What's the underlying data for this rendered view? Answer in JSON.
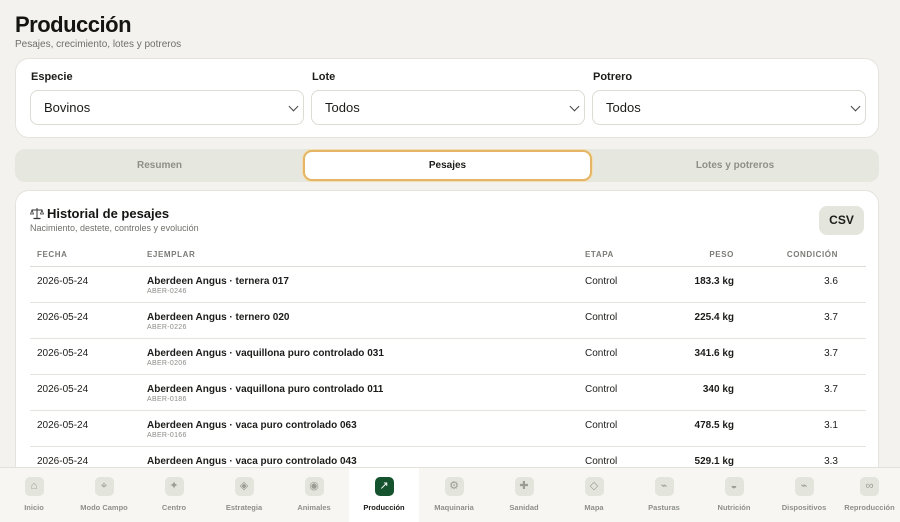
{
  "header": {
    "title": "Producción",
    "subtitle": "Pesajes, crecimiento, lotes y potreros"
  },
  "filters": [
    {
      "label": "Especie",
      "value": "Bovinos"
    },
    {
      "label": "Lote",
      "value": "Todos"
    },
    {
      "label": "Potrero",
      "value": "Todos"
    }
  ],
  "tabs": [
    {
      "label": "Resumen",
      "active": false
    },
    {
      "label": "Pesajes",
      "active": true
    },
    {
      "label": "Lotes y potreros",
      "active": false
    }
  ],
  "history": {
    "title": "Historial de pesajes",
    "subtitle": "Nacimiento, destete, controles y evolución",
    "csv_label": "CSV",
    "columns": {
      "fecha": "FECHA",
      "ejemplar": "EJEMPLAR",
      "etapa": "ETAPA",
      "peso": "PESO",
      "condicion": "CONDICIÓN"
    },
    "rows": [
      {
        "fecha": "2026-05-24",
        "ejemplar": "Aberdeen Angus · ternera 017",
        "codigo": "ABER-0246",
        "etapa": "Control",
        "peso": "183.3 kg",
        "condicion": "3.6"
      },
      {
        "fecha": "2026-05-24",
        "ejemplar": "Aberdeen Angus · ternero 020",
        "codigo": "ABER-0226",
        "etapa": "Control",
        "peso": "225.4 kg",
        "condicion": "3.7"
      },
      {
        "fecha": "2026-05-24",
        "ejemplar": "Aberdeen Angus · vaquillona puro controlado 031",
        "codigo": "ABER-0206",
        "etapa": "Control",
        "peso": "341.6 kg",
        "condicion": "3.7"
      },
      {
        "fecha": "2026-05-24",
        "ejemplar": "Aberdeen Angus · vaquillona puro controlado 011",
        "codigo": "ABER-0186",
        "etapa": "Control",
        "peso": "340 kg",
        "condicion": "3.7"
      },
      {
        "fecha": "2026-05-24",
        "ejemplar": "Aberdeen Angus · vaca puro controlado 063",
        "codigo": "ABER-0166",
        "etapa": "Control",
        "peso": "478.5 kg",
        "condicion": "3.1"
      },
      {
        "fecha": "2026-05-24",
        "ejemplar": "Aberdeen Angus · vaca puro controlado 043",
        "codigo": "",
        "etapa": "Control",
        "peso": "529.1 kg",
        "condicion": "3.3"
      }
    ]
  },
  "nav": [
    {
      "label": "Inicio",
      "icon": "home-icon",
      "glyph": "⌂"
    },
    {
      "label": "Modo Campo",
      "icon": "crosshair-icon",
      "glyph": "⌖"
    },
    {
      "label": "Centro",
      "icon": "sparkle-icon",
      "glyph": "✦"
    },
    {
      "label": "Estrategia",
      "icon": "diamond-icon",
      "glyph": "◈"
    },
    {
      "label": "Animales",
      "icon": "animal-icon",
      "glyph": "◉"
    },
    {
      "label": "Producción",
      "icon": "trend-arrow-icon",
      "glyph": "↗"
    },
    {
      "label": "Maquinaria",
      "icon": "gear-icon",
      "glyph": "⚙"
    },
    {
      "label": "Sanidad",
      "icon": "health-cross-icon",
      "glyph": "✚"
    },
    {
      "label": "Mapa",
      "icon": "map-icon",
      "glyph": "◇"
    },
    {
      "label": "Pasturas",
      "icon": "grass-icon",
      "glyph": "⌁"
    },
    {
      "label": "Nutrición",
      "icon": "nutrition-icon",
      "glyph": "◒"
    },
    {
      "label": "Dispositivos",
      "icon": "device-icon",
      "glyph": "⌁"
    },
    {
      "label": "Reproducción",
      "icon": "infinity-icon",
      "glyph": "∞"
    }
  ],
  "colors": {
    "accent": "#14532d",
    "active_tab_border": "#e3b564",
    "background": "#f3f2ee"
  }
}
